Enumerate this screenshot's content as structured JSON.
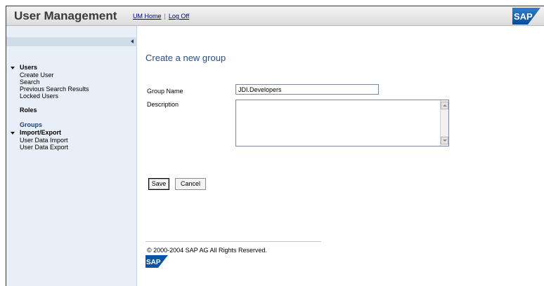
{
  "header": {
    "title": "User Management",
    "links": [
      "UM Home",
      "Log Off"
    ],
    "separator": "|",
    "logo_text": "SAP"
  },
  "sidebar": {
    "sections": [
      {
        "label": "Users",
        "expanded": true,
        "items": [
          "Create User",
          "Search",
          "Previous Search Results",
          "Locked Users"
        ]
      },
      {
        "label": "Roles"
      },
      {
        "label": "Groups",
        "active": true
      },
      {
        "label": "Import/Export",
        "expanded": true,
        "items": [
          "User Data Import",
          "User Data Export"
        ]
      }
    ]
  },
  "form": {
    "title": "Create a new group",
    "group_name_label": "Group Name",
    "group_name_value": "JDI.Developers",
    "description_label": "Description",
    "description_value": "",
    "save_label": "Save",
    "cancel_label": "Cancel"
  },
  "footer": {
    "copyright": "© 2000-2004 SAP AG All Rights Reserved.",
    "logo_text": "SAP"
  },
  "colors": {
    "title": "#2b4e80",
    "sidebar_bg": "#e8eff6",
    "sap_blue": "#0a54a3"
  }
}
